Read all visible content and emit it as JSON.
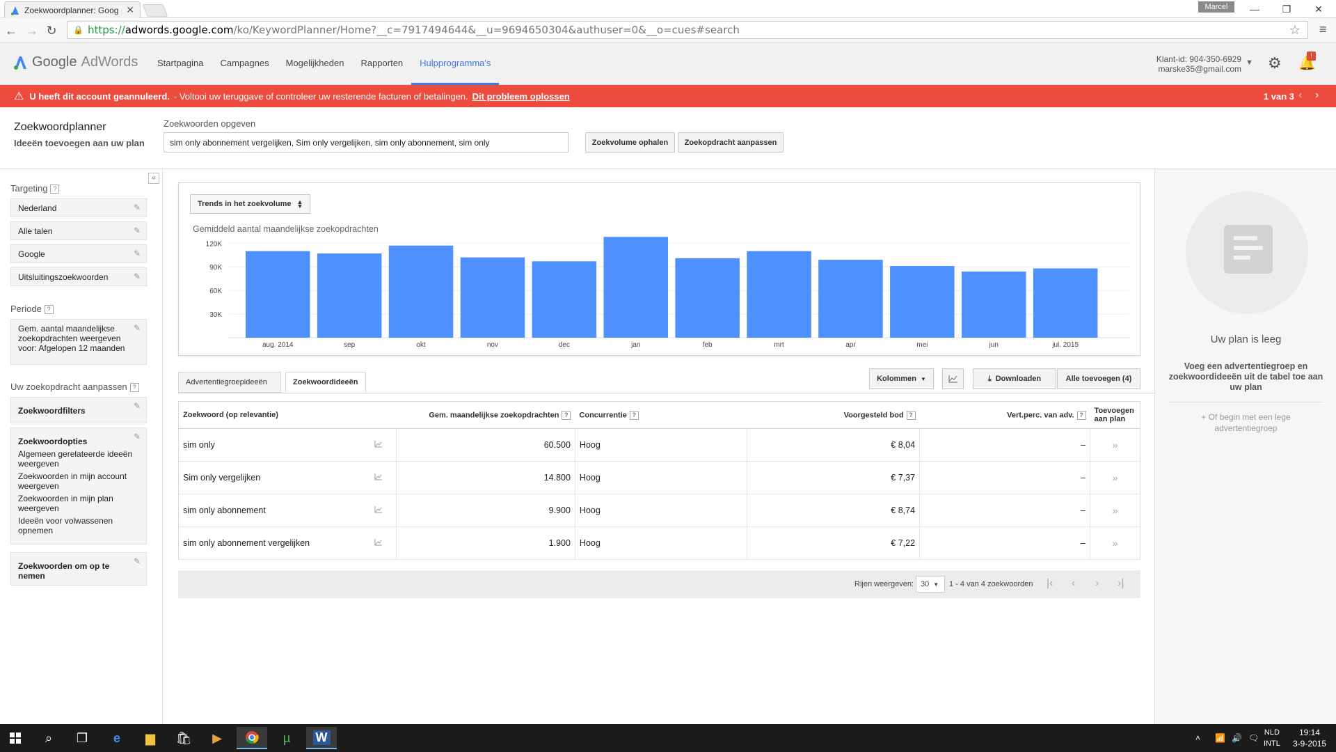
{
  "browser": {
    "tab_title": "Zoekwoordplanner: Goog",
    "user_chip": "Marcel",
    "url_scheme": "https://",
    "url_host": "adwords.google.com",
    "url_path": "/ko/KeywordPlanner/Home?__c=7917494644&__u=9694650304&authuser=0&__o=cues#search"
  },
  "header": {
    "logo_google": "Google",
    "logo_adwords": "AdWords",
    "nav": [
      "Startpagina",
      "Campagnes",
      "Mogelijkheden",
      "Rapporten",
      "Hulpprogramma's"
    ],
    "active_nav": "Hulpprogramma's",
    "client_id": "Klant-id: 904-350-6929",
    "email": "marske35@gmail.com",
    "bell_badge": "!"
  },
  "alert": {
    "strong": "U heeft dit account geannuleerd.",
    "text": "- Voltooi uw teruggave of controleer uw resterende facturen of betalingen.",
    "link": "Dit probleem oplossen",
    "pager": "1 van 3"
  },
  "planner": {
    "title": "Zoekwoordplanner",
    "subtitle": "Ideeën toevoegen aan uw plan",
    "keywords_label": "Zoekwoorden opgeven",
    "keywords_value": "sim only abonnement vergelijken, Sim only vergelijken, sim only abonnement, sim only",
    "btn_volume": "Zoekvolume ophalen",
    "btn_modify": "Zoekopdracht aanpassen"
  },
  "sidebar": {
    "targeting_label": "Targeting",
    "targeting": [
      "Nederland",
      "Alle talen",
      "Google",
      "Uitsluitingszoekwoorden"
    ],
    "period_label": "Periode",
    "period_text": "Gem. aantal maandelijkse zoekopdrachten weergeven voor: Afgelopen 12 maanden",
    "adjust_label": "Uw zoekopdracht aanpassen",
    "filters": "Zoekwoordfilters",
    "options_title": "Zoekwoordopties",
    "options": [
      "Algemeen gerelateerde ideeën weergeven",
      "Zoekwoorden in mijn account weergeven",
      "Zoekwoorden in mijn plan weergeven",
      "Ideeën voor volwassenen opnemen"
    ],
    "include": "Zoekwoorden om op te nemen"
  },
  "chart": {
    "selector": "Trends in het zoekvolume",
    "title": "Gemiddeld aantal maandelijkse zoekopdrachten"
  },
  "chart_data": {
    "type": "bar",
    "title": "Gemiddeld aantal maandelijkse zoekopdrachten",
    "categories": [
      "aug. 2014",
      "sep",
      "okt",
      "nov",
      "dec",
      "jan",
      "feb",
      "mrt",
      "apr",
      "mei",
      "jun",
      "jul. 2015"
    ],
    "values": [
      110000,
      107000,
      117000,
      102000,
      97000,
      128000,
      101000,
      110000,
      99000,
      91000,
      84000,
      88000
    ],
    "yticks": [
      "30K",
      "60K",
      "90K",
      "120K"
    ],
    "ylim": [
      0,
      130000
    ],
    "bar_color": "#4d90fe",
    "grid": true
  },
  "tabs": {
    "adgroup": "Advertentiegroepideeën",
    "keyword": "Zoekwoordideeën",
    "columns": "Kolommen",
    "download": "Downloaden",
    "add_all": "Alle toevoegen (4)"
  },
  "table": {
    "headers": {
      "keyword": "Zoekwoord (op relevantie)",
      "avg": "Gem. maandelijkse zoekopdrachten",
      "competition": "Concurrentie",
      "bid": "Voorgesteld bod",
      "share": "Vert.perc. van adv.",
      "add": "Toevoegen aan plan"
    },
    "rows": [
      {
        "keyword": "sim only",
        "avg": "60.500",
        "competition": "Hoog",
        "bid": "€ 8,04",
        "share": "–",
        "add": "»"
      },
      {
        "keyword": "Sim only vergelijken",
        "avg": "14.800",
        "competition": "Hoog",
        "bid": "€ 7,37",
        "share": "–",
        "add": "»"
      },
      {
        "keyword": "sim only abonnement",
        "avg": "9.900",
        "competition": "Hoog",
        "bid": "€ 8,74",
        "share": "–",
        "add": "»"
      },
      {
        "keyword": "sim only abonnement vergelijken",
        "avg": "1.900",
        "competition": "Hoog",
        "bid": "€ 7,22",
        "share": "–",
        "add": "»"
      }
    ]
  },
  "pagination": {
    "rows_label": "Rijen weergeven:",
    "rows_value": "30",
    "range": "1 - 4 van 4 zoekwoorden"
  },
  "plan": {
    "title": "Uw plan is leeg",
    "body": "Voeg een advertentiegroep en zoekwoordideeën uit de tabel toe aan uw plan",
    "link": "+ Of begin met een lege advertentiegroep"
  },
  "taskbar": {
    "lang1": "NLD",
    "lang2": "INTL",
    "time": "19:14",
    "date": "3-9-2015"
  }
}
